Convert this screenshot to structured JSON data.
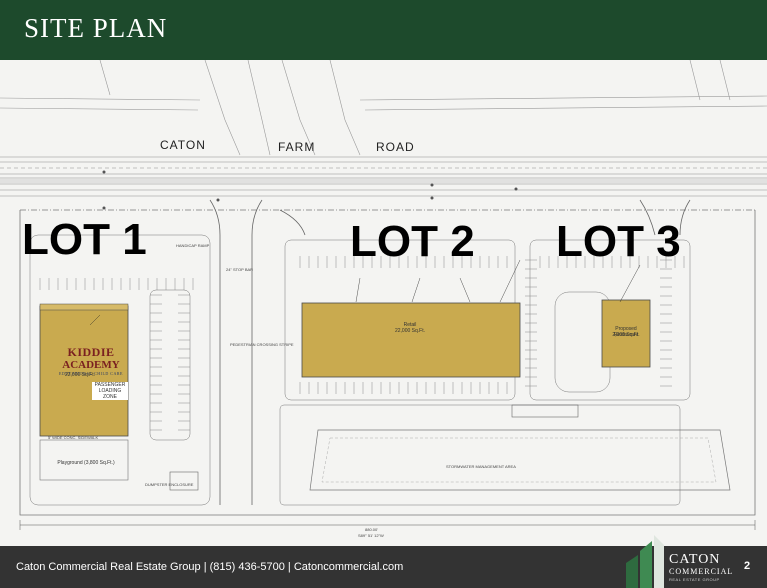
{
  "header": {
    "title": "SITE PLAN"
  },
  "road": {
    "word1": "CATON",
    "word2": "FARM",
    "word3": "ROAD"
  },
  "lots": [
    {
      "label": "LOT 1"
    },
    {
      "label": "LOT 2"
    },
    {
      "label": "LOT 3"
    }
  ],
  "buildings": {
    "lot1_area": "22,000 Sq.Ft.",
    "lot1_loading": "PASSENGER LOADING ZONE",
    "lot1_playground": "Playground (3,800 Sq.Ft.)",
    "lot2_name": "Retail",
    "lot2_area": "22,000 Sq.Ft.",
    "lot3_name": "Proposed Restaurant",
    "lot3_area": "2,000 Sq.Ft."
  },
  "notes": {
    "stormwater": "STORMWATER MANAGEMENT AREA",
    "dumpster": "DUMPSTER ENCLOSURE",
    "sidewalk": "5' WIDE CONC. SIDEWALK",
    "ped_crossing": "PEDESTRIAN CROSSING STRIPE",
    "handicap": "HANDICAP RAMP",
    "stop_bar": "24\" STOP BAR",
    "bottom_dim": "880.00'",
    "bottom_bearing": "S89° 51' 12\"W"
  },
  "tenant_logo": {
    "line1": "KIDDIE",
    "line2": "ACADEMY",
    "line3": "EDUCATIONAL CHILD CARE"
  },
  "footer": {
    "company": "Caton Commercial Real Estate Group",
    "phone": "(815) 436-5700",
    "website": "Catoncommercial.com",
    "separator": "|",
    "page_number": "2"
  },
  "brand_logo": {
    "name": "CATON",
    "sub": "COMMERCIAL",
    "sub2": "REAL ESTATE GROUP"
  },
  "colors": {
    "header_bg": "#1d4a2c",
    "footer_bg": "#333333",
    "building_fill": "#c9aa4f"
  }
}
